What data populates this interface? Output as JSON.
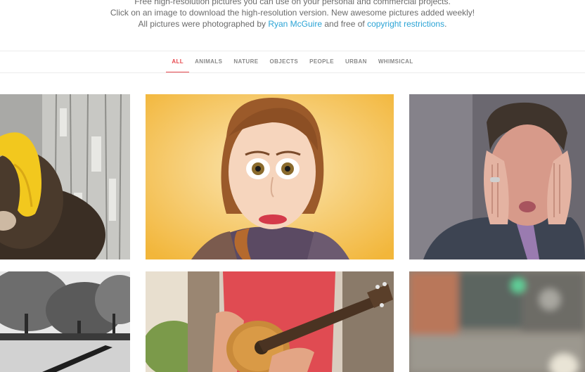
{
  "intro": {
    "line1": "Free high-resolution pictures you can use on your personal and commercial projects.",
    "line2": "Click on an image to download the high-resolution version. New awesome pictures added weekly!",
    "line3_prefix": "All pictures were photographed by ",
    "photographer": "Ryan McGuire",
    "line3_mid": " and free of ",
    "license_link": "copyright restrictions",
    "line3_suffix": "."
  },
  "nav": {
    "items": [
      "ALL",
      "ANIMALS",
      "NATURE",
      "OBJECTS",
      "PEOPLE",
      "URBAN",
      "WHIMSICAL"
    ],
    "active": "ALL"
  },
  "colors": {
    "accent": "#e8484e",
    "link": "#2aa3d5"
  },
  "gallery": {
    "photos": [
      {
        "subject": "monkey with banana"
      },
      {
        "subject": "wide-eyed woman"
      },
      {
        "subject": "man squishing face"
      },
      {
        "subject": "black and white trees"
      },
      {
        "subject": "guitar player"
      },
      {
        "subject": "blurred street"
      }
    ]
  }
}
